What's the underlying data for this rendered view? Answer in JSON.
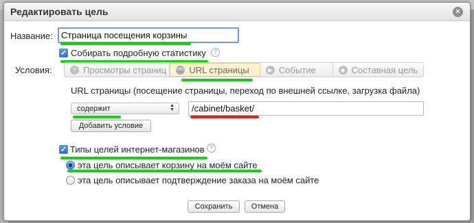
{
  "dialog": {
    "title": "Редактировать цель",
    "close_symbol": "×"
  },
  "name_field": {
    "label": "Название:",
    "value": "Страница посещения корзины"
  },
  "detailed_stats": {
    "label": "Собирать подробную статистику",
    "checked": true
  },
  "conditions": {
    "label": "Условия:",
    "tabs": [
      {
        "label": "Просмотры страниц",
        "icon": "pageviews-icon",
        "active": false
      },
      {
        "label": "URL страницы",
        "icon": "url-icon",
        "active": true
      },
      {
        "label": "Событие",
        "icon": "event-icon",
        "active": false
      },
      {
        "label": "Составная цель",
        "icon": "composite-icon",
        "active": false
      }
    ]
  },
  "url_section": {
    "description": "URL страницы (посещение страницы, переход по внешней ссылке, загрузка файла)",
    "match_type": "содержит",
    "url_value": "/cabinet/basket/",
    "add_condition_label": "Добавить условие"
  },
  "ecommerce": {
    "label": "Типы целей интернет-магазинов",
    "checked": true,
    "options": [
      {
        "label": "эта цель описывает корзину на моём сайте",
        "selected": true
      },
      {
        "label": "эта цель описывает подтверждение заказа на моём сайте",
        "selected": false
      }
    ]
  },
  "footer": {
    "save_label": "Сохранить",
    "cancel_label": "Отмена"
  },
  "annotations": {
    "green": "#16d016",
    "red": "#e8200a"
  }
}
